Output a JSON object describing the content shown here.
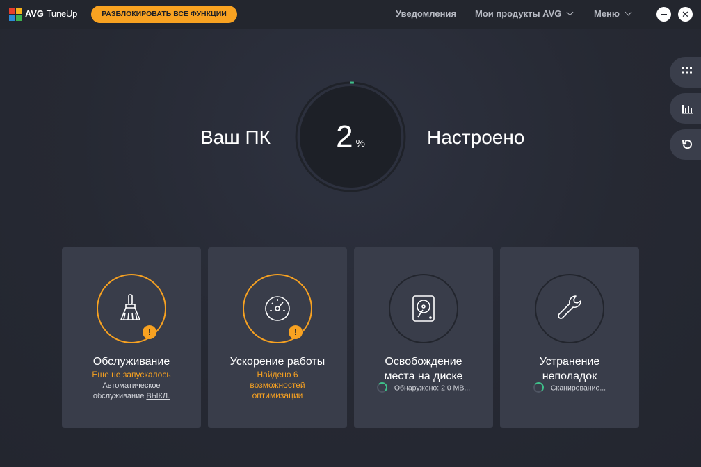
{
  "titlebar": {
    "brand": "AVG",
    "product": "TuneUp",
    "unlock_label": "РАЗБЛОКИРОВАТЬ ВСЕ ФУНКЦИИ",
    "nav": {
      "notifications": "Уведомления",
      "products": "Мои продукты AVG",
      "menu": "Меню"
    },
    "close_glyph": "✕"
  },
  "hero": {
    "left_text": "Ваш ПК",
    "right_text": "Настроено",
    "value": "2",
    "unit": "%",
    "progress": 0.02
  },
  "side_tools": [
    "grid-icon",
    "bar-chart-icon",
    "undo-icon"
  ],
  "cards": [
    {
      "title": "Обслуживание",
      "status": "Еще не запускалось",
      "sub": "Автоматическое",
      "sub2": "обслуживание",
      "link": "ВЫКЛ.",
      "icon": "broom-icon",
      "warning": "!"
    },
    {
      "title": "Ускорение работы",
      "status1": "Найдено 6",
      "status2": "возможностей",
      "status3": "оптимизации",
      "icon": "speedometer-icon",
      "warning": "!"
    },
    {
      "title1": "Освобождение",
      "title2": "места на диске",
      "scan": "Обнаружено: 2,0 МВ...",
      "icon": "hard-disk-icon"
    },
    {
      "title1": "Устранение",
      "title2": "неполадок",
      "scan": "Сканирование...",
      "icon": "wrench-icon"
    }
  ],
  "colors": {
    "accent": "#f8a221",
    "progress": "#3fc08a",
    "background": "#262933",
    "card": "#393d4a"
  }
}
